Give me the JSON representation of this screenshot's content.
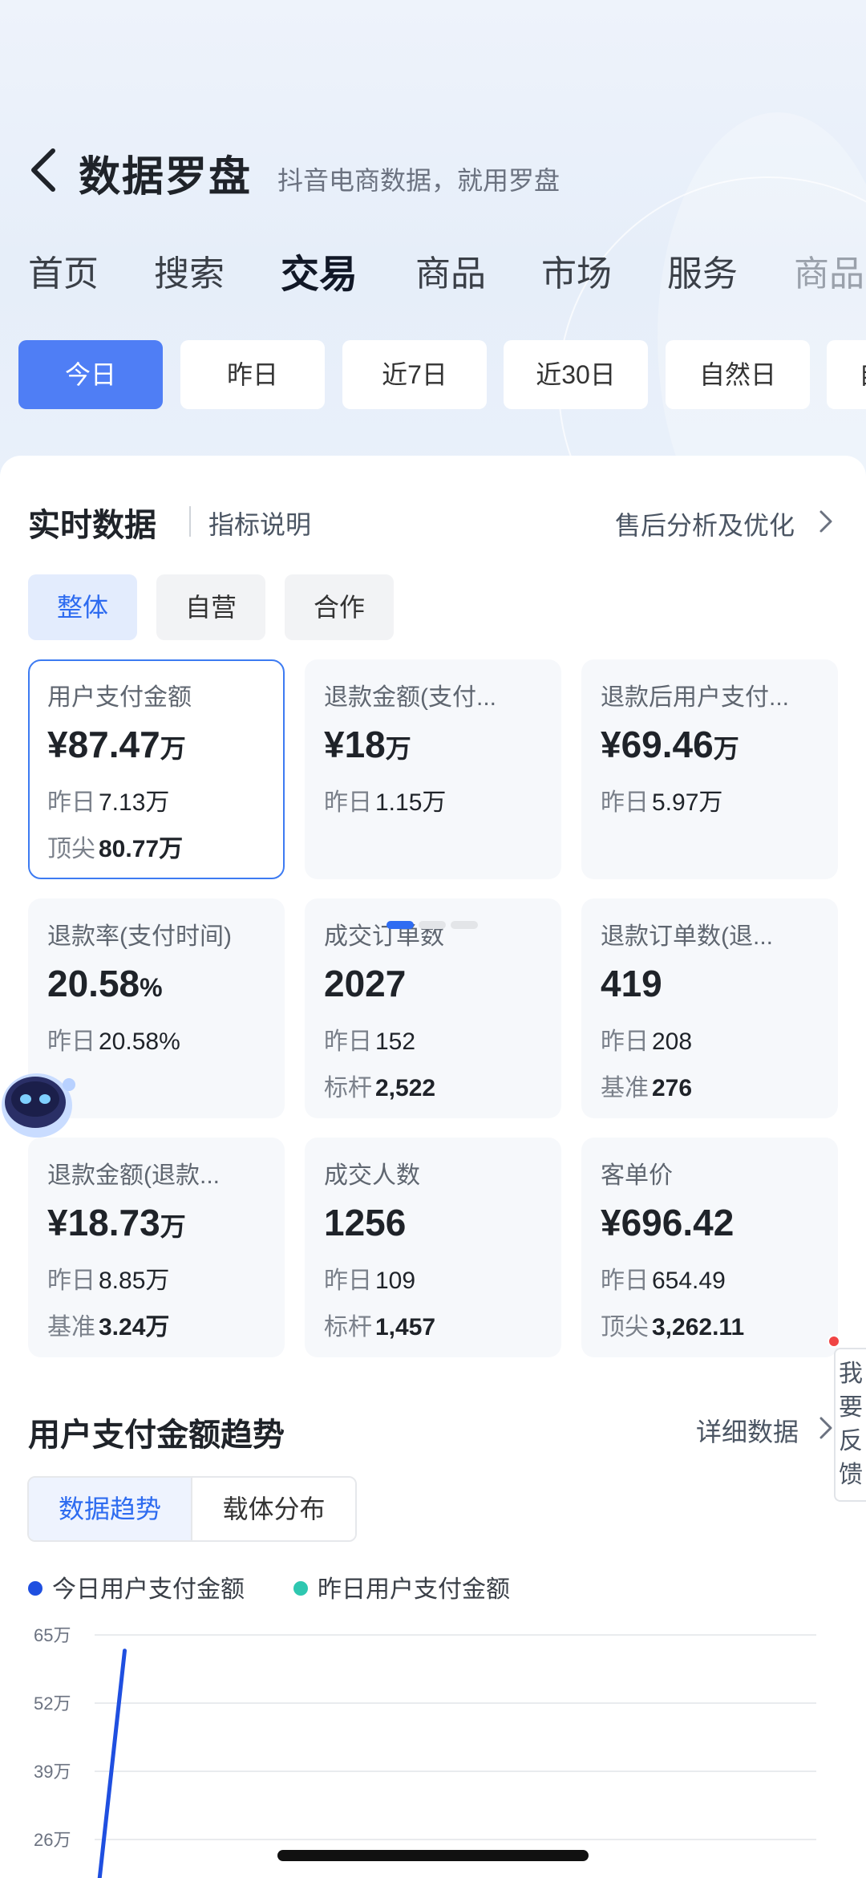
{
  "header": {
    "title": "数据罗盘",
    "subtitle": "抖音电商数据，就用罗盘"
  },
  "main_tabs": [
    {
      "label": "首页"
    },
    {
      "label": "搜索"
    },
    {
      "label": "交易"
    },
    {
      "label": "商品"
    },
    {
      "label": "市场"
    },
    {
      "label": "服务"
    },
    {
      "label": "商品"
    }
  ],
  "active_main_tab": "交易",
  "date_filters": [
    {
      "label": "今日"
    },
    {
      "label": "昨日"
    },
    {
      "label": "近7日"
    },
    {
      "label": "近30日"
    },
    {
      "label": "自然日"
    },
    {
      "label": "自"
    }
  ],
  "active_date_filter": "今日",
  "realtime": {
    "title": "实时数据",
    "help_link": "指标说明",
    "after_sales_link": "售后分析及优化"
  },
  "segments": [
    {
      "label": "整体"
    },
    {
      "label": "自营"
    },
    {
      "label": "合作"
    }
  ],
  "active_segment": "整体",
  "metrics": [
    {
      "label": "用户支付金额",
      "prefix": "¥",
      "value": "87.47",
      "unit": "万",
      "sub1_k": "昨日",
      "sub1_v": "7.13万",
      "sub2_k": "顶尖",
      "sub2_v": "80.77万"
    },
    {
      "label": "退款金额(支付...",
      "prefix": "¥",
      "value": "18",
      "unit": "万",
      "sub1_k": "昨日",
      "sub1_v": "1.15万",
      "sub2_k": "",
      "sub2_v": ""
    },
    {
      "label": "退款后用户支付...",
      "prefix": "¥",
      "value": "69.46",
      "unit": "万",
      "sub1_k": "昨日",
      "sub1_v": "5.97万",
      "sub2_k": "",
      "sub2_v": ""
    },
    {
      "label": "退款率(支付时间)",
      "prefix": "",
      "value": "20.58",
      "unit": "%",
      "sub1_k": "昨日",
      "sub1_v": "20.58%",
      "sub2_k": "",
      "sub2_v": ""
    },
    {
      "label": "成交订单数",
      "prefix": "",
      "value": "2027",
      "unit": "",
      "sub1_k": "昨日",
      "sub1_v": "152",
      "sub2_k": "标杆",
      "sub2_v": "2,522"
    },
    {
      "label": "退款订单数(退...",
      "prefix": "",
      "value": "419",
      "unit": "",
      "sub1_k": "昨日",
      "sub1_v": "208",
      "sub2_k": "基准",
      "sub2_v": "276"
    },
    {
      "label": "退款金额(退款...",
      "prefix": "¥",
      "value": "18.73",
      "unit": "万",
      "sub1_k": "昨日",
      "sub1_v": "8.85万",
      "sub2_k": "基准",
      "sub2_v": "3.24万"
    },
    {
      "label": "成交人数",
      "prefix": "",
      "value": "1256",
      "unit": "",
      "sub1_k": "昨日",
      "sub1_v": "109",
      "sub2_k": "标杆",
      "sub2_v": "1,457"
    },
    {
      "label": "客单价",
      "prefix": "¥",
      "value": "696.42",
      "unit": "",
      "sub1_k": "昨日",
      "sub1_v": "654.49",
      "sub2_k": "顶尖",
      "sub2_v": "3,262.11"
    }
  ],
  "pager": {
    "count": 3,
    "active": 0
  },
  "trend": {
    "title": "用户支付金额趋势",
    "detail_link": "详细数据",
    "tabs": [
      {
        "label": "数据趋势"
      },
      {
        "label": "载体分布"
      }
    ],
    "active_tab": "数据趋势"
  },
  "chart_data": {
    "type": "line",
    "series": [
      {
        "name": "今日用户支付金额",
        "color": "#1f4fe0",
        "x": [
          0,
          1
        ],
        "values": [
          10,
          62
        ]
      },
      {
        "name": "昨日用户支付金额",
        "color": "#2ec7b0",
        "x": [],
        "values": []
      }
    ],
    "y_ticks": [
      "65万",
      "52万",
      "39万",
      "26万"
    ],
    "y_tick_values": [
      65,
      52,
      39,
      26
    ],
    "ylim": [
      0,
      65
    ],
    "xlim": [
      0,
      24
    ],
    "grid": true,
    "legend_position": "top-left"
  },
  "feedback_label": "我要反馈",
  "colors": {
    "accent": "#4f7ef5",
    "selected_border": "#3d7bf2",
    "pager_active": "#2f6cf2"
  }
}
